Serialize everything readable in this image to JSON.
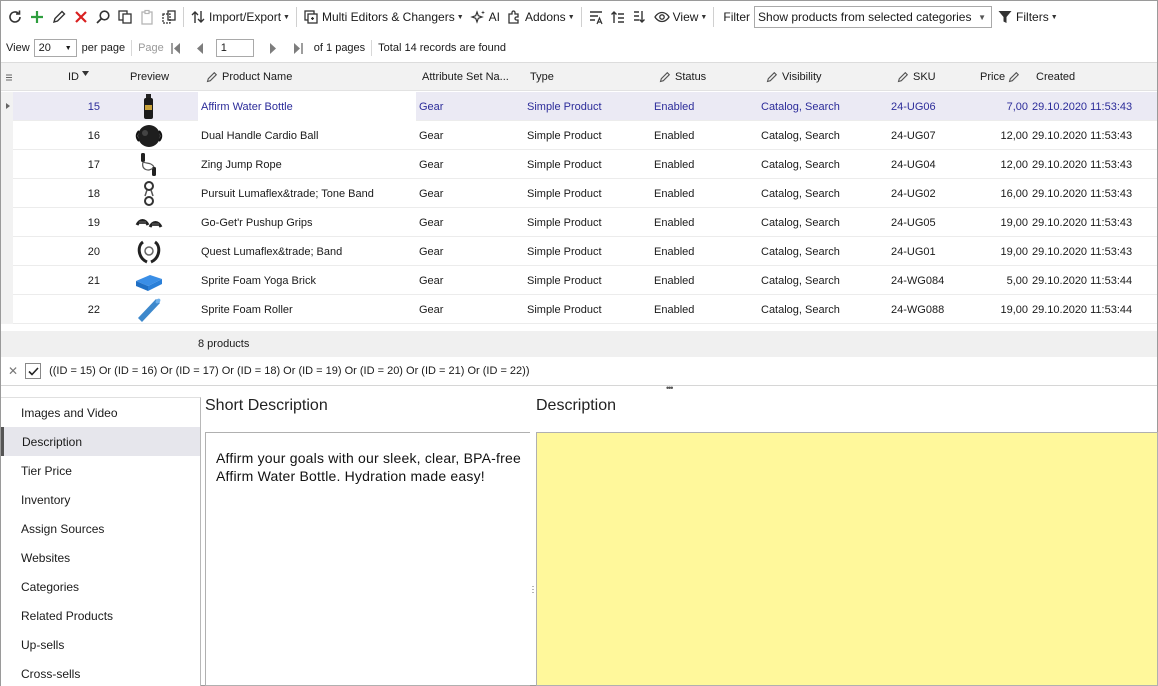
{
  "toolbar": {
    "import_export_label": "Import/Export",
    "multi_editors_label": "Multi Editors & Changers",
    "ai_label": "AI",
    "addons_label": "Addons",
    "view_label": "View",
    "filter_label": "Filter",
    "filter_value": "Show products from selected categories",
    "filters_label": "Filters"
  },
  "pager": {
    "view_label": "View",
    "view_value": "20",
    "per_page_label": "per page",
    "page_label": "Page",
    "page_value": "1",
    "of_pages_label": "of 1 pages",
    "total_label": "Total 14 records are found"
  },
  "grid": {
    "columns": {
      "id": "ID",
      "preview": "Preview",
      "product_name": "Product Name",
      "attribute_set": "Attribute Set Na...",
      "type": "Type",
      "status": "Status",
      "visibility": "Visibility",
      "sku": "SKU",
      "price": "Price",
      "created": "Created"
    },
    "rows": [
      {
        "id": "15",
        "name": "Affirm Water Bottle",
        "attr": "Gear",
        "type": "Simple Product",
        "status": "Enabled",
        "visibility": "Catalog, Search",
        "sku": "24-UG06",
        "price": "7,00",
        "created": "29.10.2020 11:53:43",
        "thumb": "water-bottle"
      },
      {
        "id": "16",
        "name": "Dual Handle Cardio Ball",
        "attr": "Gear",
        "type": "Simple Product",
        "status": "Enabled",
        "visibility": "Catalog, Search",
        "sku": "24-UG07",
        "price": "12,00",
        "created": "29.10.2020 11:53:43",
        "thumb": "cardio-ball"
      },
      {
        "id": "17",
        "name": "Zing Jump Rope",
        "attr": "Gear",
        "type": "Simple Product",
        "status": "Enabled",
        "visibility": "Catalog, Search",
        "sku": "24-UG04",
        "price": "12,00",
        "created": "29.10.2020 11:53:43",
        "thumb": "jump-rope"
      },
      {
        "id": "18",
        "name": "Pursuit Lumaflex&trade; Tone Band",
        "attr": "Gear",
        "type": "Simple Product",
        "status": "Enabled",
        "visibility": "Catalog, Search",
        "sku": "24-UG02",
        "price": "16,00",
        "created": "29.10.2020 11:53:43",
        "thumb": "tone-band"
      },
      {
        "id": "19",
        "name": "Go-Get'r Pushup Grips",
        "attr": "Gear",
        "type": "Simple Product",
        "status": "Enabled",
        "visibility": "Catalog, Search",
        "sku": "24-UG05",
        "price": "19,00",
        "created": "29.10.2020 11:53:43",
        "thumb": "pushup-grips"
      },
      {
        "id": "20",
        "name": "Quest Lumaflex&trade; Band",
        "attr": "Gear",
        "type": "Simple Product",
        "status": "Enabled",
        "visibility": "Catalog, Search",
        "sku": "24-UG01",
        "price": "19,00",
        "created": "29.10.2020 11:53:43",
        "thumb": "band"
      },
      {
        "id": "21",
        "name": "Sprite Foam Yoga Brick",
        "attr": "Gear",
        "type": "Simple Product",
        "status": "Enabled",
        "visibility": "Catalog, Search",
        "sku": "24-WG084",
        "price": "5,00",
        "created": "29.10.2020 11:53:44",
        "thumb": "yoga-brick"
      },
      {
        "id": "22",
        "name": "Sprite Foam Roller",
        "attr": "Gear",
        "type": "Simple Product",
        "status": "Enabled",
        "visibility": "Catalog, Search",
        "sku": "24-WG088",
        "price": "19,00",
        "created": "29.10.2020 11:53:44",
        "thumb": "foam-roller"
      }
    ],
    "footer_count": "8 products"
  },
  "filter_expression": "((ID = 15) Or (ID = 16) Or (ID = 17) Or (ID = 18) Or (ID = 19) Or (ID = 20) Or (ID = 21) Or (ID = 22))",
  "sidebar": {
    "items": [
      {
        "label": "Images and Video"
      },
      {
        "label": "Description",
        "active": true
      },
      {
        "label": "Tier Price"
      },
      {
        "label": "Inventory"
      },
      {
        "label": "Assign Sources"
      },
      {
        "label": "Websites"
      },
      {
        "label": "Categories"
      },
      {
        "label": "Related Products"
      },
      {
        "label": "Up-sells"
      },
      {
        "label": "Cross-sells"
      }
    ]
  },
  "detail": {
    "short_description_title": "Short Description",
    "short_description_text": "Affirm your goals with our sleek, clear, BPA-free Affirm Water Bottle. Hydration made easy!",
    "description_title": "Description",
    "description_text": ""
  },
  "colors": {
    "selected_row": "#ebeaf4",
    "selected_text": "#2c2c9a",
    "description_bg": "#fff89b",
    "add_icon": "#2e9e3e",
    "delete_icon": "#d92020"
  }
}
